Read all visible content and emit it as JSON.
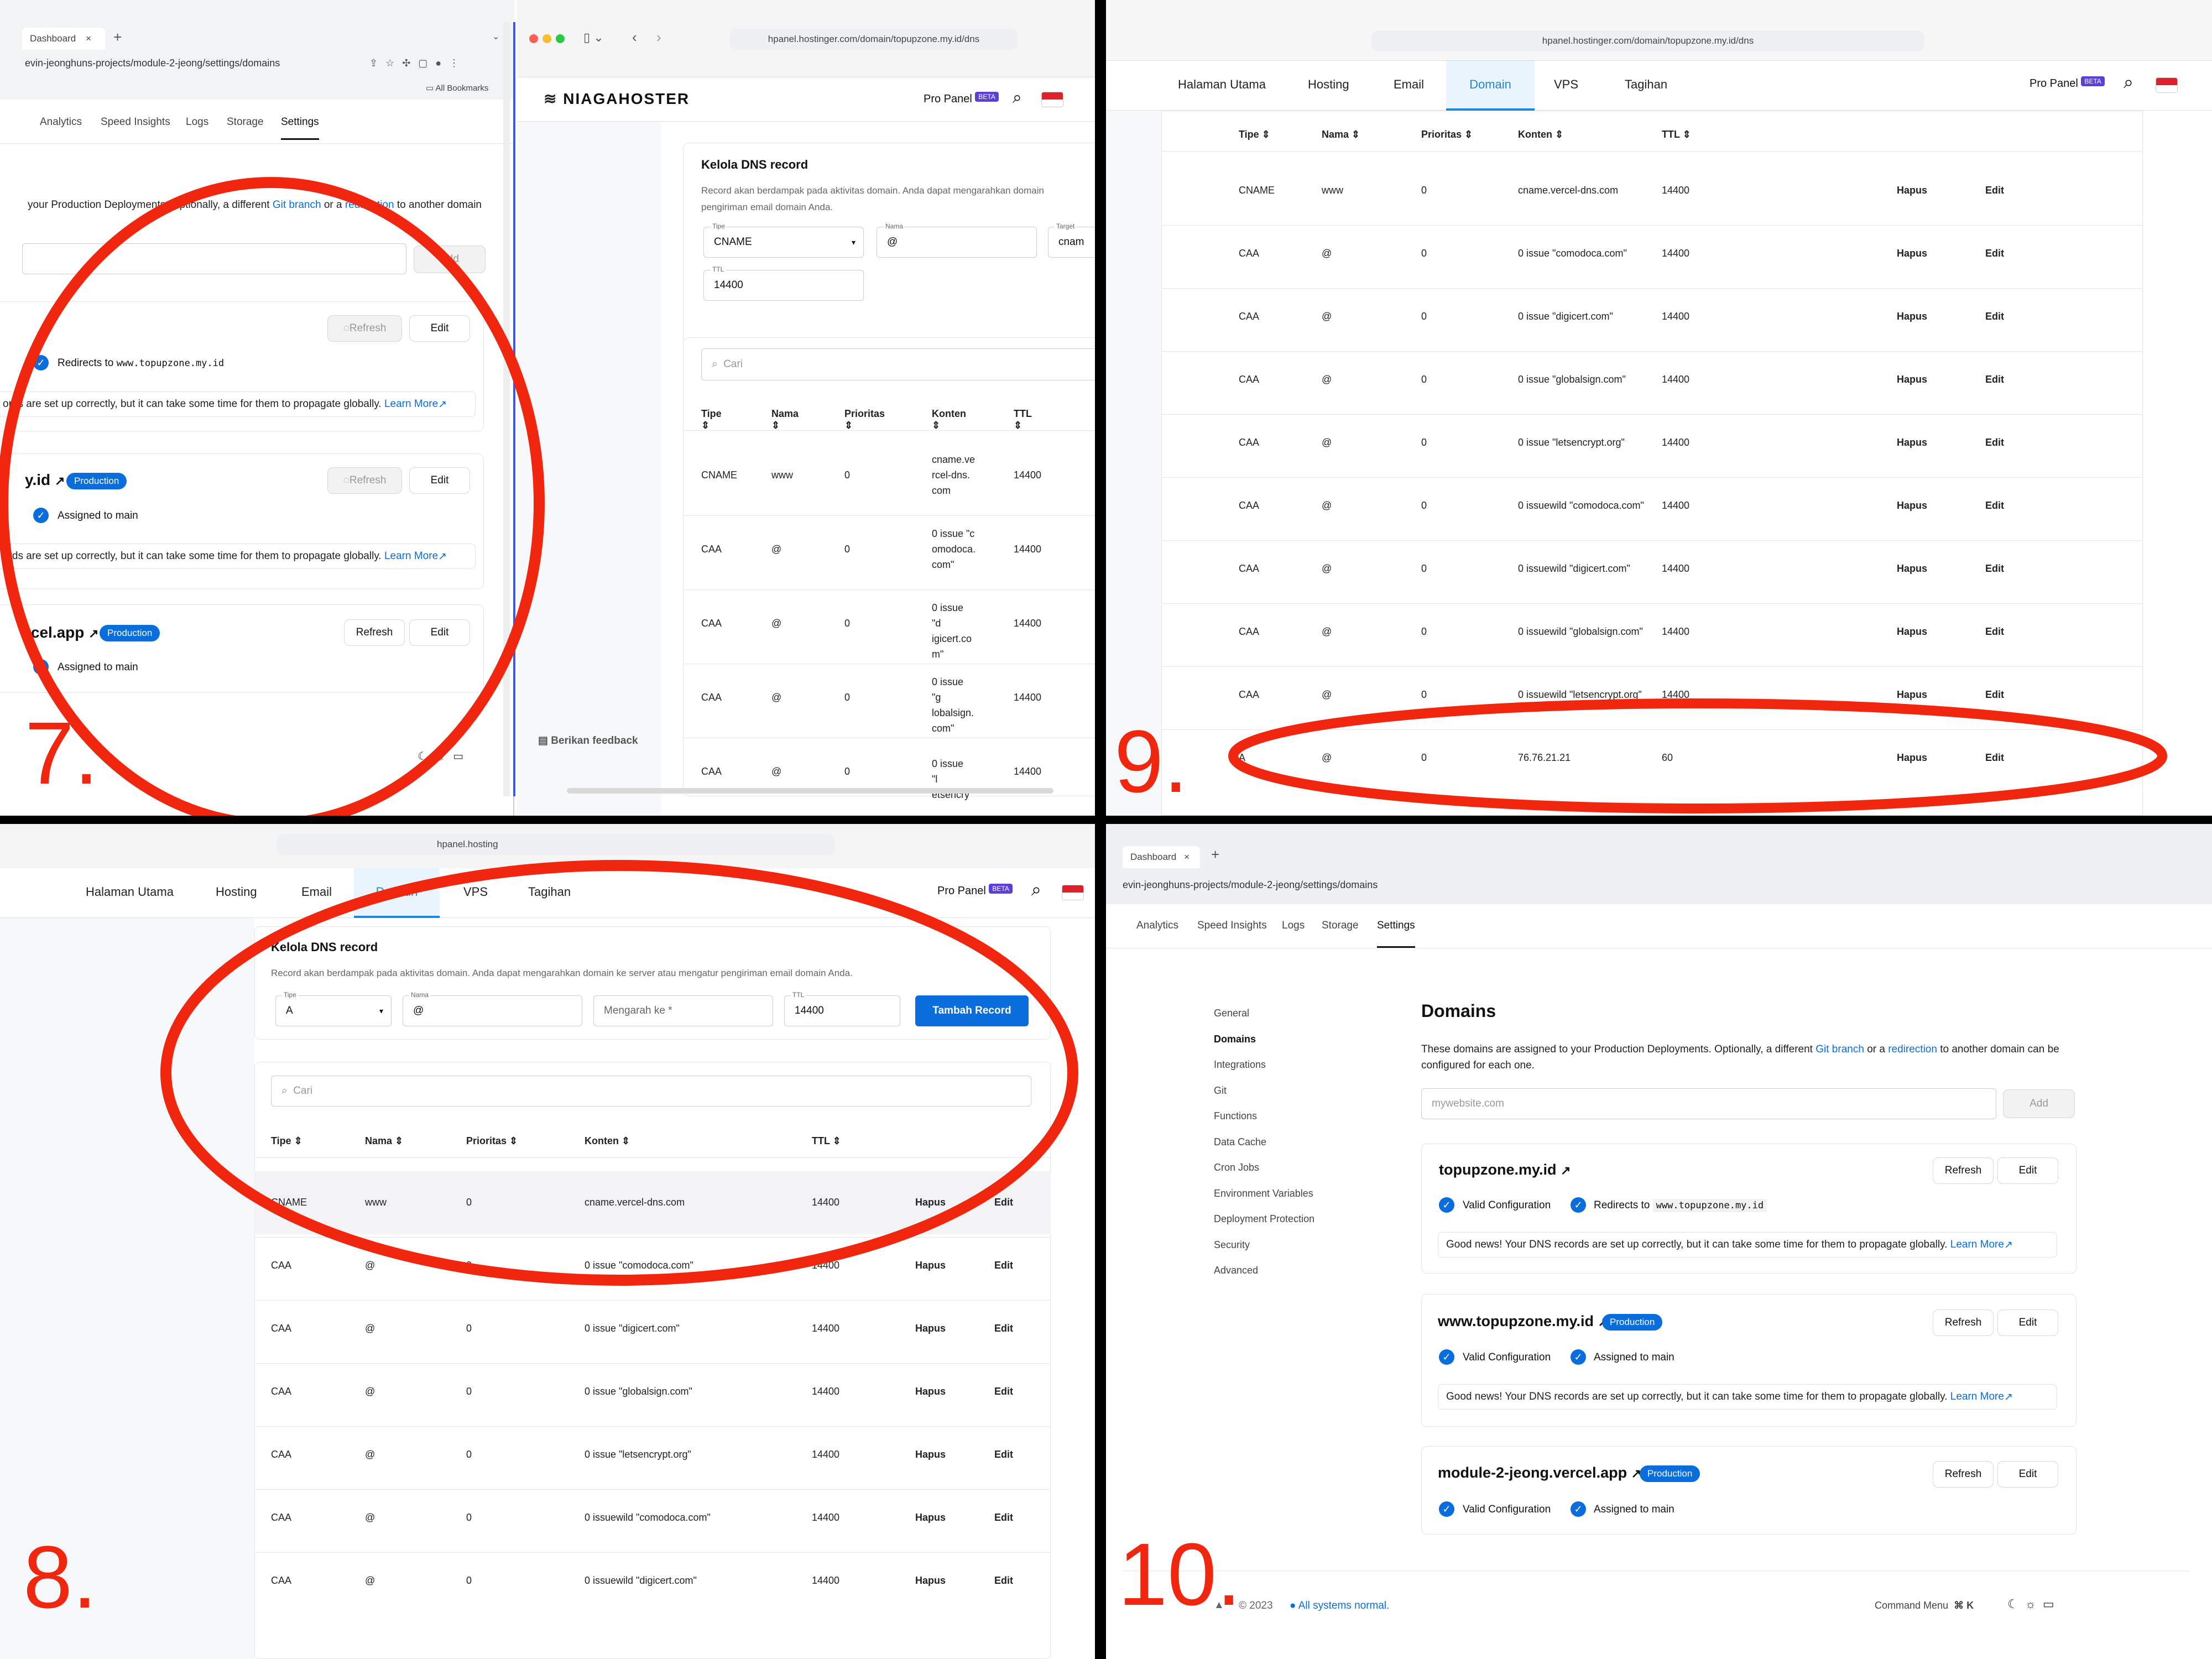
{
  "labels": {
    "p7": "7.",
    "p8": "8.",
    "p9": "9.",
    "p10": "10."
  },
  "colors": {
    "annotation": "#f0260f",
    "link": "#0a6ddc",
    "hapus": "#e0306a",
    "edit": "#1e74d8",
    "tab_active": "#1e88d8",
    "beta": "#5b3fd6"
  },
  "vercel": {
    "browser_tab": "Dashboard",
    "url": "evin-jeonghuns-projects/module-2-jeong/settings/domains",
    "bookmarks": "All Bookmarks",
    "tabs": [
      "Analytics",
      "Speed Insights",
      "Logs",
      "Storage",
      "Settings"
    ],
    "sidebar": [
      "General",
      "Domains",
      "Integrations",
      "Git",
      "Functions",
      "Data Cache",
      "Cron Jobs",
      "Environment Variables",
      "Deployment Protection",
      "Security",
      "Advanced"
    ],
    "heading": "Domains",
    "description_1": "These domains are assigned to your Production Deployments. Optionally, a different",
    "git_branch": "Git branch",
    "or_a": "or a",
    "redirection": "redirection",
    "description_2": "to another domain can be",
    "description_3": "configured for each one.",
    "p7_desc_1": "your Production Deployments. Optionally, a different",
    "p7_desc_2": "to another domain",
    "input_placeholder": "mywebsite.com",
    "add": "Add",
    "refresh": "Refresh",
    "edit": "Edit",
    "valid": "Valid Configuration",
    "redirects_to": "Redirects to",
    "redirect_target": "www.topupzone.my.id",
    "assigned": "Assigned to main",
    "production": "Production",
    "good_news": "Good news! Your DNS records are set up correctly, but it can take some time for them to propagate globally.",
    "p7_good_news": "ords are set up correctly, but it can take some time for them to propagate globally.",
    "learn_more": "Learn More",
    "domains": [
      "topupzone.my.id",
      "www.topupzone.my.id",
      "module-2-jeong.vercel.app"
    ],
    "p7_domain_2": "y.id",
    "p7_domain_3": "rcel.app",
    "copyright": "© 2023",
    "status": "All systems normal.",
    "command_menu": "Command Menu",
    "cmd_keys": [
      "⌘",
      "K"
    ]
  },
  "hostinger": {
    "url": "hpanel.hostinger.com/domain/topupzone.my.id/dns",
    "url_short": "hpanel.hosting",
    "brand": "NIAGAHOSTER",
    "pro_panel": "Pro Panel",
    "beta": "BETA",
    "nav": [
      "Halaman Utama",
      "Hosting",
      "Email",
      "Domain",
      "VPS",
      "Tagihan"
    ],
    "kelola_title": "Kelola DNS record",
    "kelola_desc": "Record akan berdampak pada aktivitas domain. Anda dapat mengarahkan domain ke server atau mengatur pengiriman email domain Anda.",
    "p7_desc_1": "Record akan berdampak pada aktivitas domain. Anda dapat mengarahkan domain",
    "p7_desc_2": "pengiriman email domain Anda.",
    "form_p7": {
      "tipe_label": "Tipe",
      "tipe": "CNAME",
      "nama_label": "Nama",
      "nama": "@",
      "target_label": "Target",
      "target": "cnam",
      "ttl_label": "TTL",
      "ttl": "14400"
    },
    "form_p8": {
      "tipe_label": "Tipe",
      "tipe": "A",
      "nama_label": "Nama",
      "nama": "@",
      "mengarah": "Mengarah ke",
      "ttl_label": "TTL",
      "ttl": "14400",
      "submit": "Tambah Record"
    },
    "search": "Cari",
    "headers": [
      "Tipe",
      "Nama",
      "Prioritas",
      "Konten",
      "TTL"
    ],
    "hapus": "Hapus",
    "edit": "Edit",
    "feedback": "Berikan feedback",
    "p7_rows": [
      {
        "tipe": "CNAME",
        "nama": "www",
        "prio": "0",
        "konten": [
          "cname.ve",
          "rcel-dns.",
          "com"
        ],
        "ttl": "14400"
      },
      {
        "tipe": "CAA",
        "nama": "@",
        "prio": "0",
        "konten": [
          "0 issue \"c",
          "omodoca.",
          "com\""
        ],
        "ttl": "14400"
      },
      {
        "tipe": "CAA",
        "nama": "@",
        "prio": "0",
        "konten": [
          "0 issue \"d",
          "igicert.co",
          "m\""
        ],
        "ttl": "14400"
      },
      {
        "tipe": "CAA",
        "nama": "@",
        "prio": "0",
        "konten": [
          "0 issue \"g",
          "lobalsign.",
          "com\""
        ],
        "ttl": "14400"
      },
      {
        "tipe": "CAA",
        "nama": "@",
        "prio": "0",
        "konten": [
          "0 issue \"l",
          "etsencry"
        ],
        "ttl": "14400"
      }
    ],
    "records": [
      {
        "tipe": "CNAME",
        "nama": "www",
        "prio": "0",
        "konten": "cname.vercel-dns.com",
        "ttl": "14400"
      },
      {
        "tipe": "CAA",
        "nama": "@",
        "prio": "0",
        "konten": "0 issue \"comodoca.com\"",
        "ttl": "14400"
      },
      {
        "tipe": "CAA",
        "nama": "@",
        "prio": "0",
        "konten": "0 issue \"digicert.com\"",
        "ttl": "14400"
      },
      {
        "tipe": "CAA",
        "nama": "@",
        "prio": "0",
        "konten": "0 issue \"globalsign.com\"",
        "ttl": "14400"
      },
      {
        "tipe": "CAA",
        "nama": "@",
        "prio": "0",
        "konten": "0 issue \"letsencrypt.org\"",
        "ttl": "14400"
      },
      {
        "tipe": "CAA",
        "nama": "@",
        "prio": "0",
        "konten": "0 issuewild \"comodoca.com\"",
        "ttl": "14400"
      },
      {
        "tipe": "CAA",
        "nama": "@",
        "prio": "0",
        "konten": "0 issuewild \"digicert.com\"",
        "ttl": "14400"
      },
      {
        "tipe": "CAA",
        "nama": "@",
        "prio": "0",
        "konten": "0 issuewild \"globalsign.com\"",
        "ttl": "14400"
      },
      {
        "tipe": "CAA",
        "nama": "@",
        "prio": "0",
        "konten": "0 issuewild \"letsencrypt.org\"",
        "ttl": "14400"
      },
      {
        "tipe": "A",
        "nama": "@",
        "prio": "0",
        "konten": "76.76.21.21",
        "ttl": "60"
      }
    ]
  }
}
